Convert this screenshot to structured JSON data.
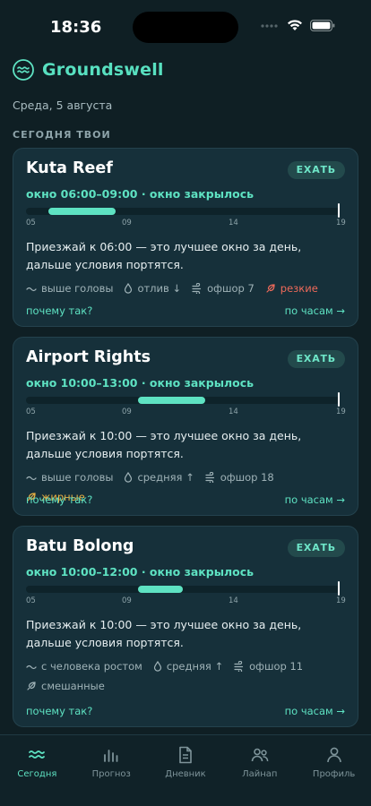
{
  "status": {
    "time": "18:36"
  },
  "app": {
    "name": "Groundswell"
  },
  "date": "Среда, 5 августа",
  "section_title": "СЕГОДНЯ ТВОИ",
  "colors": {
    "accent": "#5ee2c2",
    "warn": "#ef6a5a",
    "amber": "#e8b042",
    "background": "#0f1f24"
  },
  "ticks": [
    "05",
    "09",
    "14",
    "19"
  ],
  "cards": [
    {
      "name": "Kuta Reef",
      "go_label": "ЕХАТЬ",
      "window": "окно 06:00–09:00 · окно закрылось",
      "window_start_hour": 6,
      "window_end_hour": 9,
      "now_hour": 19,
      "advice": "Приезжай к 06:00 — это лучшее окно за день, дальше условия портятся.",
      "conditions": [
        {
          "icon": "wave-icon",
          "text": "выше головы",
          "tone": "neutral"
        },
        {
          "icon": "drop-icon",
          "text": "отлив ↓",
          "tone": "neutral"
        },
        {
          "icon": "wind-icon",
          "text": "офшор 7",
          "tone": "neutral"
        },
        {
          "icon": "leaf-icon",
          "text": "резкие",
          "tone": "warn"
        }
      ],
      "why_label": "почему так?",
      "hourly_label": "по часам →"
    },
    {
      "name": "Airport Rights",
      "go_label": "ЕХАТЬ",
      "window": "окно 10:00–13:00 · окно закрылось",
      "window_start_hour": 10,
      "window_end_hour": 13,
      "now_hour": 19,
      "advice": "Приезжай к 10:00 — это лучшее окно за день, дальше условия портятся.",
      "conditions": [
        {
          "icon": "wave-icon",
          "text": "выше головы",
          "tone": "neutral"
        },
        {
          "icon": "drop-icon",
          "text": "средняя ↑",
          "tone": "neutral"
        },
        {
          "icon": "wind-icon",
          "text": "офшор 18",
          "tone": "neutral"
        },
        {
          "icon": "leaf-icon",
          "text": "жирные",
          "tone": "amber"
        }
      ],
      "why_label": "почему так?",
      "hourly_label": "по часам →"
    },
    {
      "name": "Batu Bolong",
      "go_label": "ЕХАТЬ",
      "window": "окно 10:00–12:00 · окно закрылось",
      "window_start_hour": 10,
      "window_end_hour": 12,
      "now_hour": 19,
      "advice": "Приезжай к 10:00 — это лучшее окно за день, дальше условия портятся.",
      "conditions": [
        {
          "icon": "wave-icon",
          "text": "с человека ростом",
          "tone": "neutral"
        },
        {
          "icon": "drop-icon",
          "text": "средняя ↑",
          "tone": "neutral"
        },
        {
          "icon": "wind-icon",
          "text": "офшор 11",
          "tone": "neutral"
        },
        {
          "icon": "leaf-icon",
          "text": "смешанные",
          "tone": "neutral"
        }
      ],
      "why_label": "почему так?",
      "hourly_label": "по часам →"
    }
  ],
  "nav": [
    {
      "label": "Сегодня",
      "icon": "waves-icon",
      "active": true
    },
    {
      "label": "Прогноз",
      "icon": "bar-chart-icon",
      "active": false
    },
    {
      "label": "Дневник",
      "icon": "document-icon",
      "active": false
    },
    {
      "label": "Лайнап",
      "icon": "people-icon",
      "active": false
    },
    {
      "label": "Профиль",
      "icon": "person-icon",
      "active": false
    }
  ]
}
